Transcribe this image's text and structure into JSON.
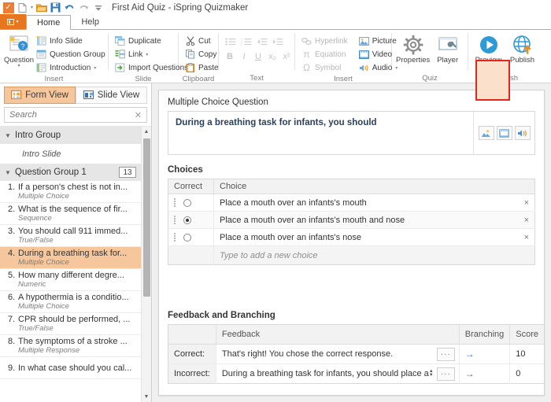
{
  "window": {
    "title": "First Aid Quiz - iSpring Quizmaker",
    "quick_access": [
      {
        "name": "app-icon",
        "glyph": "✓"
      },
      {
        "name": "new-icon",
        "glyph": "new"
      },
      {
        "name": "open-icon",
        "glyph": "folder"
      },
      {
        "name": "save-icon",
        "glyph": "save"
      },
      {
        "name": "undo-icon",
        "glyph": "↺"
      },
      {
        "name": "redo-icon",
        "glyph": "↻"
      },
      {
        "name": "qat-more-icon",
        "glyph": "▾"
      }
    ]
  },
  "tabs": {
    "file_label": "",
    "items": [
      {
        "label": "Home",
        "active": true
      },
      {
        "label": "Help",
        "active": false
      }
    ]
  },
  "ribbon": {
    "groups": [
      {
        "name": "insert",
        "label": "Insert",
        "big_button": {
          "label": "Question"
        },
        "items": [
          {
            "label": "Info Slide",
            "icon": "info-slide-icon",
            "disabled": false,
            "caret": false
          },
          {
            "label": "Question Group",
            "icon": "question-group-icon",
            "disabled": false,
            "caret": false
          },
          {
            "label": "Introduction",
            "icon": "introduction-icon",
            "disabled": false,
            "caret": true
          }
        ]
      },
      {
        "name": "slide",
        "label": "Slide",
        "items": [
          {
            "label": "Duplicate",
            "icon": "duplicate-icon",
            "disabled": false,
            "caret": false
          },
          {
            "label": "Link",
            "icon": "link-icon",
            "disabled": false,
            "caret": true
          },
          {
            "label": "Import Questions",
            "icon": "import-questions-icon",
            "disabled": false,
            "caret": false
          }
        ]
      },
      {
        "name": "clipboard",
        "label": "Clipboard",
        "items": [
          {
            "label": "Cut",
            "icon": "cut-icon",
            "disabled": false,
            "caret": false
          },
          {
            "label": "Copy",
            "icon": "copy-icon",
            "disabled": false,
            "caret": false
          },
          {
            "label": "Paste",
            "icon": "paste-icon",
            "disabled": false,
            "caret": false
          }
        ]
      },
      {
        "name": "text",
        "label": "Text",
        "list_buttons": [
          "bullet-list-icon",
          "numbered-list-icon",
          "decrease-indent-icon",
          "increase-indent-icon"
        ],
        "format_buttons": [
          {
            "label": "B",
            "name": "bold-button"
          },
          {
            "label": "I",
            "name": "italic-button"
          },
          {
            "label": "U",
            "name": "underline-button"
          },
          {
            "label": "x₂",
            "name": "subscript-button"
          },
          {
            "label": "x²",
            "name": "superscript-button"
          }
        ]
      },
      {
        "name": "insert-media",
        "label": "Insert",
        "items_left": [
          {
            "label": "Hyperlink",
            "icon": "hyperlink-icon",
            "disabled": true,
            "caret": false
          },
          {
            "label": "Equation",
            "icon": "equation-icon",
            "disabled": true,
            "caret": false
          },
          {
            "label": "Symbol",
            "icon": "symbol-icon",
            "disabled": true,
            "caret": false
          }
        ],
        "items_right": [
          {
            "label": "Picture",
            "icon": "picture-icon",
            "disabled": false,
            "caret": false
          },
          {
            "label": "Video",
            "icon": "video-icon",
            "disabled": false,
            "caret": false
          },
          {
            "label": "Audio",
            "icon": "audio-icon",
            "disabled": false,
            "caret": true
          }
        ]
      },
      {
        "name": "quiz",
        "label": "Quiz",
        "buttons": [
          {
            "label": "Properties",
            "icon": "gear-icon"
          },
          {
            "label": "Player",
            "icon": "player-wrench-icon"
          }
        ]
      },
      {
        "name": "publish",
        "label": "Publish",
        "buttons": [
          {
            "label": "Preview",
            "icon": "preview-play-icon",
            "caret": true
          },
          {
            "label": "Publish",
            "icon": "publish-globe-icon",
            "highlighted": true
          }
        ],
        "highlight_color": "#e8251a"
      }
    ]
  },
  "sidebar": {
    "view_tabs": [
      {
        "label": "Form View",
        "icon": "form-view-icon",
        "selected": true
      },
      {
        "label": "Slide View",
        "icon": "slide-view-icon",
        "selected": false
      }
    ],
    "search": {
      "value": "",
      "placeholder": "Search",
      "clear_icon": "clear-icon"
    },
    "groups": [
      {
        "label": "Intro Group",
        "badge": "",
        "expanded": true,
        "slides": [
          {
            "label": "Intro Slide"
          }
        ]
      },
      {
        "label": "Question Group 1",
        "badge": "13",
        "expanded": true,
        "slides": []
      }
    ],
    "questions": [
      {
        "num": "1.",
        "title": "If a person's chest is not in...",
        "type": "Multiple Choice",
        "selected": false
      },
      {
        "num": "2.",
        "title": "What is the sequence of fir...",
        "type": "Sequence",
        "selected": false
      },
      {
        "num": "3.",
        "title": "You should call 911 immed...",
        "type": "True/False",
        "selected": false
      },
      {
        "num": "4.",
        "title": "During a breathing task for...",
        "type": "Multiple Choice",
        "selected": true
      },
      {
        "num": "5.",
        "title": "How many different degre...",
        "type": "Numeric",
        "selected": false
      },
      {
        "num": "6.",
        "title": "A hypothermia is a conditio...",
        "type": "Multiple Choice",
        "selected": false
      },
      {
        "num": "7.",
        "title": "CPR should be performed, ...",
        "type": "True/False",
        "selected": false
      },
      {
        "num": "8.",
        "title": "The symptoms of a stroke ...",
        "type": "Multiple Response",
        "selected": false
      },
      {
        "num": "9.",
        "title": "In what case should you cal...",
        "type": "",
        "selected": false
      }
    ]
  },
  "editor": {
    "question_type_label": "Multiple Choice Question",
    "question_text": "During a breathing task for infants, you should",
    "media_buttons": [
      {
        "name": "insert-picture-button",
        "icon": "picture-icon"
      },
      {
        "name": "insert-video-button",
        "icon": "video-icon"
      },
      {
        "name": "insert-audio-button",
        "icon": "audio-icon"
      }
    ],
    "choices_section": {
      "title": "Choices",
      "headers": [
        "Correct",
        "Choice"
      ],
      "rows": [
        {
          "correct": false,
          "text": "Place a mouth over an infants's mouth"
        },
        {
          "correct": true,
          "text": "Place a mouth over an infants's mouth and nose"
        },
        {
          "correct": false,
          "text": "Place a mouth over an infants's nose"
        }
      ],
      "add_placeholder": "Type to add a new choice",
      "remove_icon": "×"
    },
    "feedback_section": {
      "title": "Feedback and Branching",
      "headers": [
        "",
        "Feedback",
        "Branching",
        "Score"
      ],
      "rows": [
        {
          "label": "Correct:",
          "feedback": "That's right! You chose the correct response.",
          "branching": "→",
          "score": "10",
          "spinner": false
        },
        {
          "label": "Incorrect:",
          "feedback": "During a breathing task for infants, you should place a",
          "branching": "→",
          "score": "0",
          "spinner": true
        }
      ],
      "ellipsis_label": "···"
    }
  }
}
